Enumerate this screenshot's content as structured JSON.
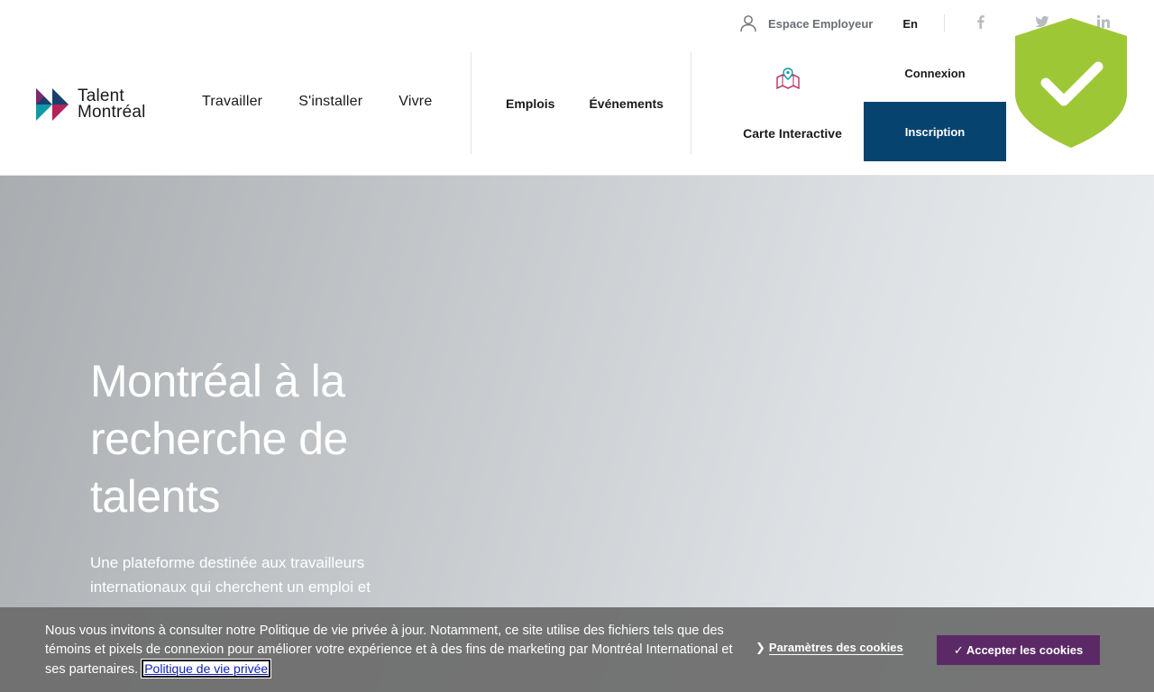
{
  "brand": {
    "line1": "Talent",
    "line2": "Montréal"
  },
  "topbar": {
    "employer_label": "Espace Employeur",
    "lang_label": "En",
    "social": [
      "facebook-icon",
      "twitter-icon",
      "linkedin-icon"
    ]
  },
  "main_nav": [
    "Travailler",
    "S'installer",
    "Vivre"
  ],
  "sub_nav": [
    "Emplois",
    "Événements"
  ],
  "map": {
    "label": "Carte Interactive"
  },
  "auth": {
    "login_label": "Connexion",
    "signup_label": "Inscription"
  },
  "hero": {
    "title": "Montréal à la recherche de talents",
    "subtitle": "Une plateforme destinée aux travailleurs internationaux qui cherchent un emploi et"
  },
  "cookie": {
    "text": "Nous vous invitons à consulter notre Politique de vie privée à jour. Notamment, ce site utilise des fichiers tels que des témoins et pixels de connexion pour améliorer votre expérience et à des fins de marketing par Montréal International et ses partenaires.",
    "policy_link": "Politique de vie privée",
    "settings_label": "Paramètres des cookies",
    "accept_label": "✓ Accepter les cookies"
  },
  "colors": {
    "primary": "#07436f",
    "accept": "#5b2a66",
    "shield": "#9ec735",
    "logo_magenta": "#b5215a",
    "logo_teal": "#0f9aa8",
    "logo_navy": "#1b3f6b"
  }
}
